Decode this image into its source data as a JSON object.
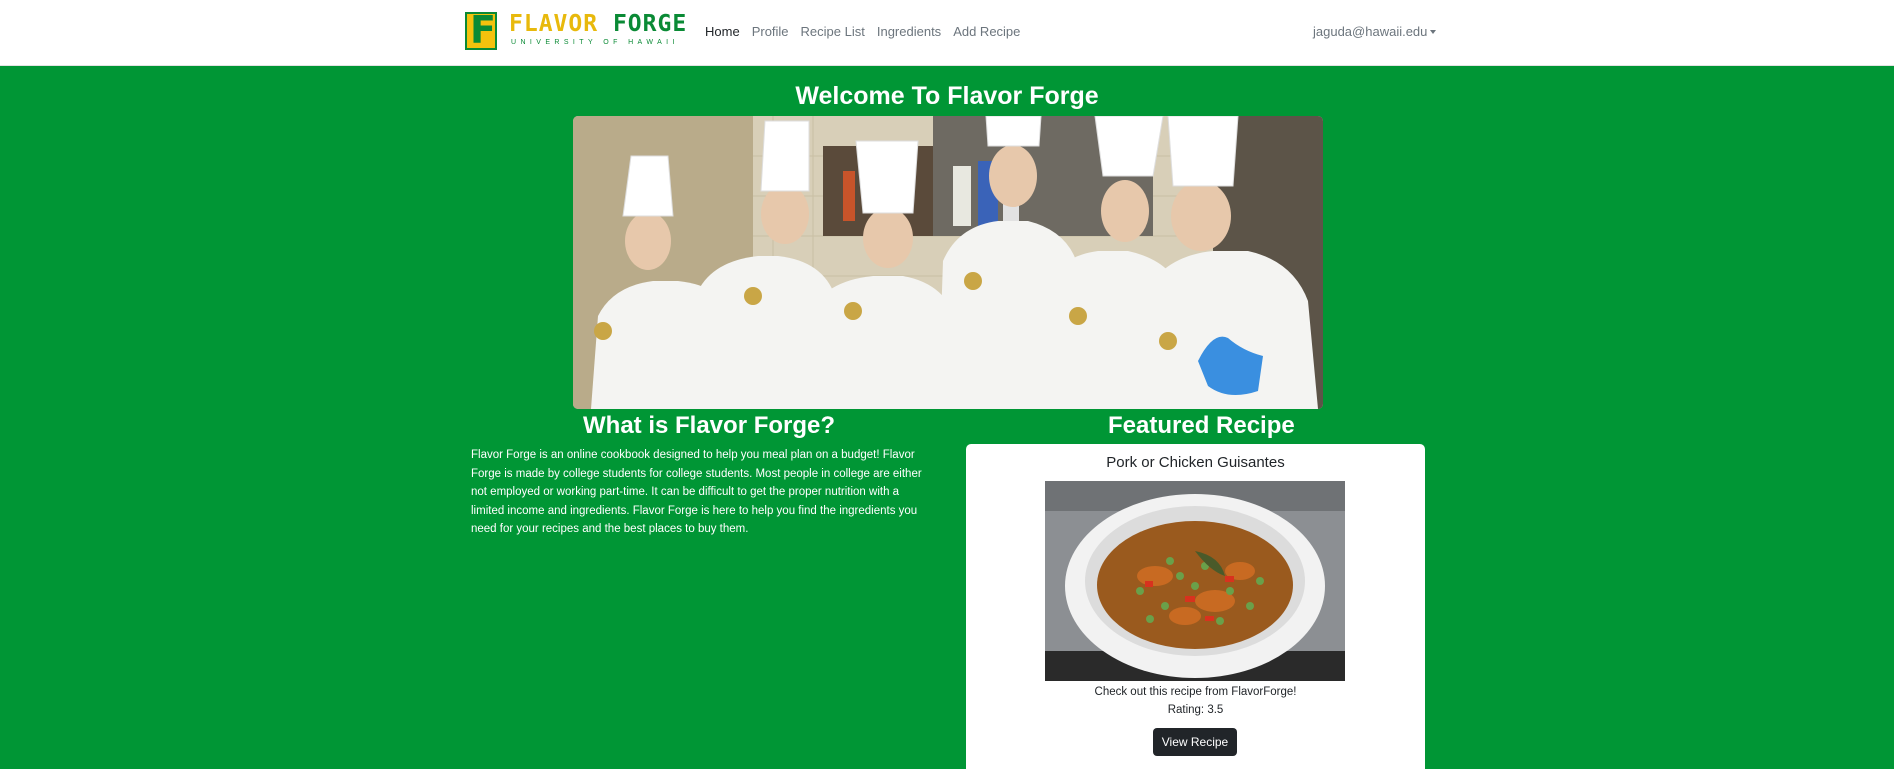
{
  "brand": {
    "wordmark_part1": "FLAVOR",
    "wordmark_part2": "FORGE",
    "tagline": "UNIVERSITY OF HAWAII",
    "logo_icon": "f-letter-logo-icon"
  },
  "nav": {
    "links": [
      {
        "label": "Home",
        "active": true
      },
      {
        "label": "Profile",
        "active": false
      },
      {
        "label": "Recipe List",
        "active": false
      },
      {
        "label": "Ingredients",
        "active": false
      },
      {
        "label": "Add Recipe",
        "active": false
      }
    ],
    "user": "jaguda@hawaii.edu",
    "user_icon": "chevron-down-icon"
  },
  "main": {
    "title": "Welcome To Flavor Forge",
    "hero_image": "chefs-group-photo"
  },
  "about": {
    "title": "What is Flavor Forge?",
    "text": "Flavor Forge is an online cookbook designed to help you meal plan on a budget! Flavor Forge is made by college students for college students. Most people in college are either not employed or working part-time. It can be difficult to get the proper nutrition with a limited income and ingredients. Flavor Forge is here to help you find the ingredients you need for your recipes and the best places to buy them."
  },
  "featured": {
    "title": "Featured Recipe",
    "recipe_name": "Pork or Chicken Guisantes",
    "recipe_image": "stew-pot-photo",
    "description": "Check out this recipe from FlavorForge!",
    "rating": "Rating: 3.5",
    "button_label": "View Recipe"
  },
  "colors": {
    "page_green": "#009635",
    "brand_yellow": "#e8b90c",
    "brand_green": "#0a8a35",
    "button_dark": "#212529"
  }
}
